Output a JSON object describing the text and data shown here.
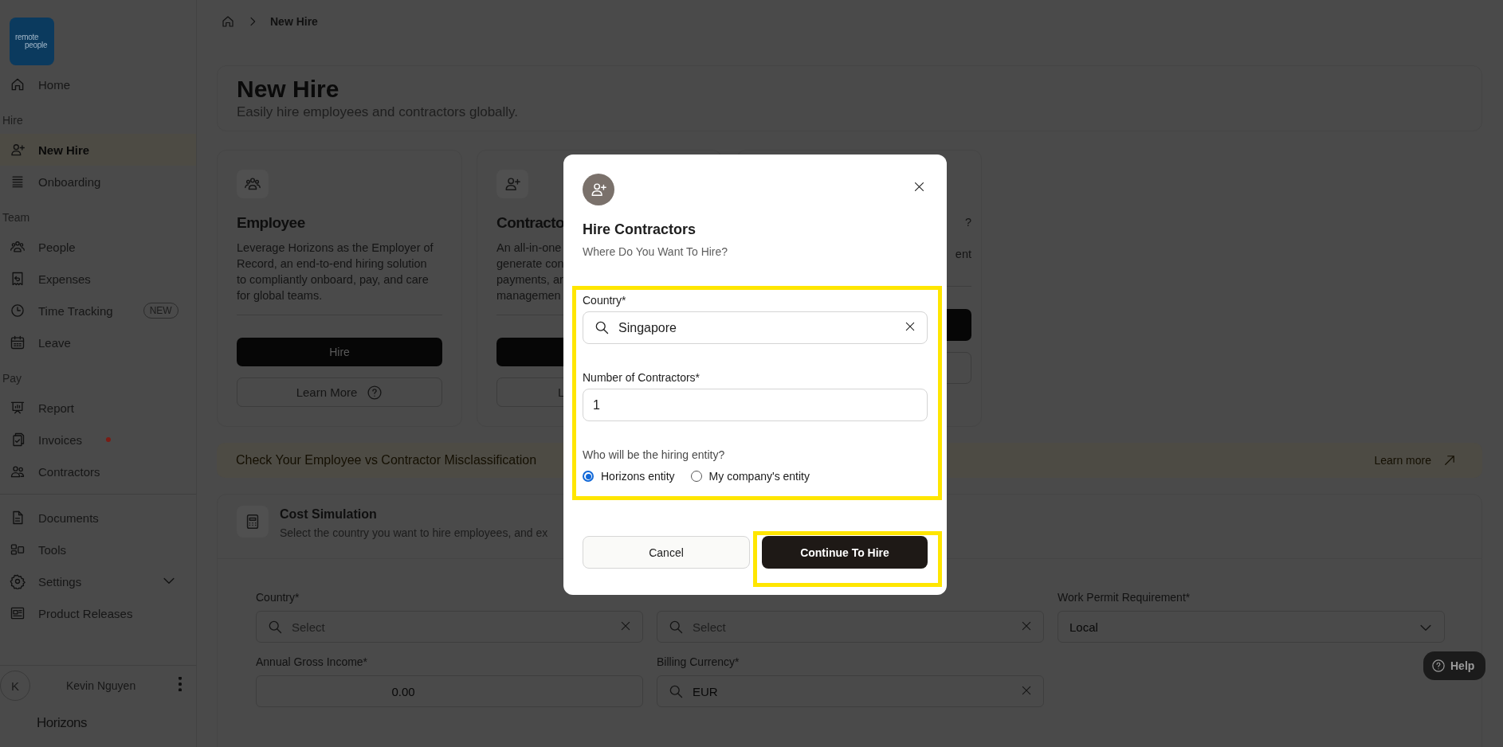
{
  "sidebar": {
    "logo_text": [
      "remote",
      "people"
    ],
    "sections": [
      {
        "items": [
          {
            "label": "Home",
            "kind": "link",
            "selected": false
          }
        ]
      },
      {
        "heading": "Hire",
        "items": [
          {
            "label": "New Hire",
            "kind": "link",
            "selected": true
          },
          {
            "label": "Onboarding",
            "kind": "link",
            "selected": false
          }
        ]
      },
      {
        "heading": "Team",
        "items": [
          {
            "label": "People",
            "kind": "link",
            "selected": false
          },
          {
            "label": "Expenses",
            "kind": "link",
            "selected": false
          },
          {
            "label": "Time Tracking",
            "kind": "link",
            "selected": false,
            "badge": "NEW"
          },
          {
            "label": "Leave",
            "kind": "link",
            "selected": false
          }
        ]
      },
      {
        "heading": "Pay",
        "items": [
          {
            "label": "Report",
            "kind": "link",
            "selected": false
          },
          {
            "label": "Invoices",
            "kind": "link",
            "selected": false,
            "color": "#7a1c14"
          },
          {
            "label": "Contractors",
            "kind": "link",
            "selected": false
          }
        ]
      },
      {
        "items": [
          {
            "label": "Documents",
            "kind": "link",
            "selected": false
          },
          {
            "label": "Tools",
            "kind": "link",
            "selected": false
          },
          {
            "label": "Settings",
            "kind": "group",
            "selected": false
          },
          {
            "label": "Product Releases",
            "kind": "link",
            "selected": false
          }
        ]
      }
    ],
    "user": {
      "initial": "K",
      "name": "Kevin Nguyen"
    },
    "brand": "Horizons"
  },
  "breadcrumb": {
    "current": "New Hire"
  },
  "header": {
    "title": "New Hire",
    "subtitle": "Easily hire employees and contractors globally."
  },
  "cards": [
    {
      "title": "Employee",
      "description": [
        "Leverage Horizons as the Employer of",
        "Record, an end-to-end hiring solution",
        "to compliantly onboard, pay, and care",
        "for global teams."
      ],
      "primary": "Hire",
      "secondary": "Learn More"
    },
    {
      "title": "Contracto",
      "description": [
        "An all-in-one",
        "generate con",
        "payments, ar",
        "managemen"
      ],
      "secondary": "L"
    },
    {
      "description": [
        "?",
        "ent"
      ]
    }
  ],
  "banner": {
    "text": "Check Your Employee vs Contractor Misclassification",
    "link": "Learn more"
  },
  "cost_simulation": {
    "title": "Cost Simulation",
    "subtitle": "Select the country you want to hire employees, and ex",
    "fields": [
      {
        "kind": "search",
        "label": "Country*",
        "placeholder": "Select"
      },
      {
        "kind": "search",
        "placeholder": "Select"
      },
      {
        "kind": "select",
        "label": "Work Permit Requirement*",
        "value": "Local"
      },
      {
        "kind": "amount",
        "label": "Annual Gross Income*",
        "value": "0.00"
      },
      {
        "kind": "search",
        "label": "Billing Currency*",
        "value": "EUR"
      }
    ]
  },
  "help": "Help",
  "modal": {
    "title": "Hire Contractors",
    "subtitle": "Where Do You Want To Hire?",
    "fields": [
      {
        "kind": "search",
        "label": "Country*",
        "value": "Singapore"
      },
      {
        "kind": "number",
        "label": "Number of Contractors*",
        "value": "1"
      }
    ],
    "question": "Who will be the hiring entity?",
    "options": [
      {
        "label": "Horizons entity",
        "selected": true
      },
      {
        "label": "My company's entity",
        "selected": false
      }
    ],
    "buttons": [
      {
        "label": "Cancel",
        "kind": "secondary"
      },
      {
        "label": "Continue To Hire",
        "kind": "primary"
      }
    ]
  }
}
